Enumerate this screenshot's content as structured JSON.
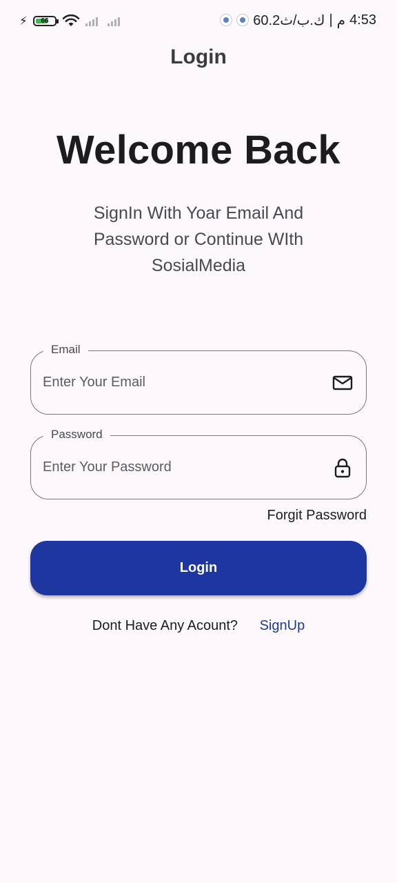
{
  "status_bar": {
    "battery_level": "66",
    "time": "4:53",
    "network_text": "60.2ك.ب/ث",
    "ampm": "م",
    "separator": "|"
  },
  "app_bar": {
    "title": "Login"
  },
  "welcome": {
    "title": "Welcome Back",
    "subtitle": "SignIn With Yoar Email And Password or Continue WIth SosialMedia"
  },
  "email_field": {
    "label": "Email",
    "placeholder": "Enter Your Email",
    "value": "",
    "icon": "mail-icon"
  },
  "password_field": {
    "label": "Password",
    "placeholder": "Enter Your Password",
    "value": "",
    "icon": "lock-icon"
  },
  "forgot_password": "Forgit Password",
  "login_button": "Login",
  "signup": {
    "prompt": "Dont Have Any Acount?",
    "link": "SignUp"
  },
  "colors": {
    "background": "#fdf8fc",
    "primary": "#1e37a0",
    "link": "#1e3a9a",
    "outline": "#79747e",
    "battery": "#35c142"
  }
}
